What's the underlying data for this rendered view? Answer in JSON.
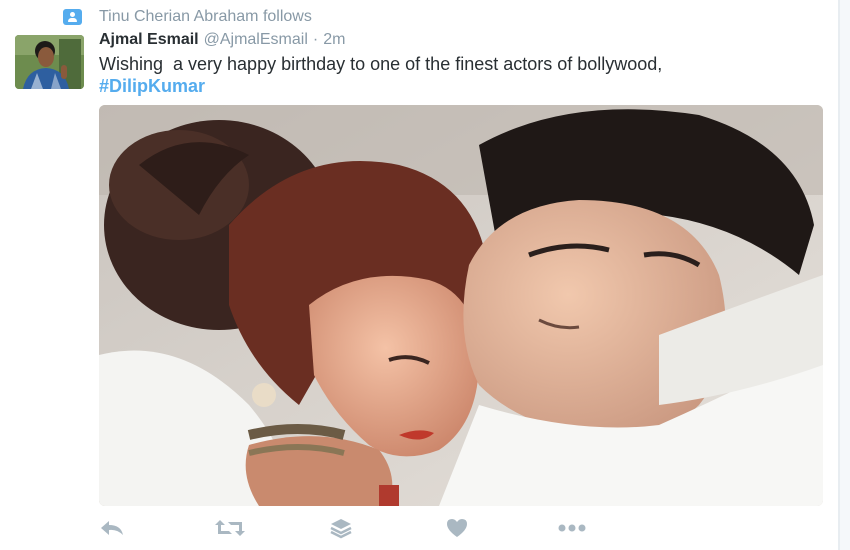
{
  "context": {
    "text": "Tinu Cherian Abraham follows",
    "icon": "follow-person-icon"
  },
  "tweet": {
    "author": {
      "name": "Ajmal Esmail",
      "handle": "@AjmalEsmail"
    },
    "separator": "·",
    "time": "2m",
    "text": "Wishing  a very happy birthday to one of the finest actors of bollywood, ",
    "hashtag": "#DilipKumar",
    "media_alt": "photo of a couple embracing"
  },
  "actions": [
    {
      "name": "reply",
      "icon": "reply-icon"
    },
    {
      "name": "retweet",
      "icon": "retweet-icon"
    },
    {
      "name": "save",
      "icon": "layers-icon"
    },
    {
      "name": "like",
      "icon": "heart-icon"
    },
    {
      "name": "more",
      "icon": "more-dots-icon"
    }
  ],
  "colors": {
    "accent": "#55acee",
    "muted": "#8899a6",
    "text": "#292f33",
    "icon": "#aab8c2"
  }
}
